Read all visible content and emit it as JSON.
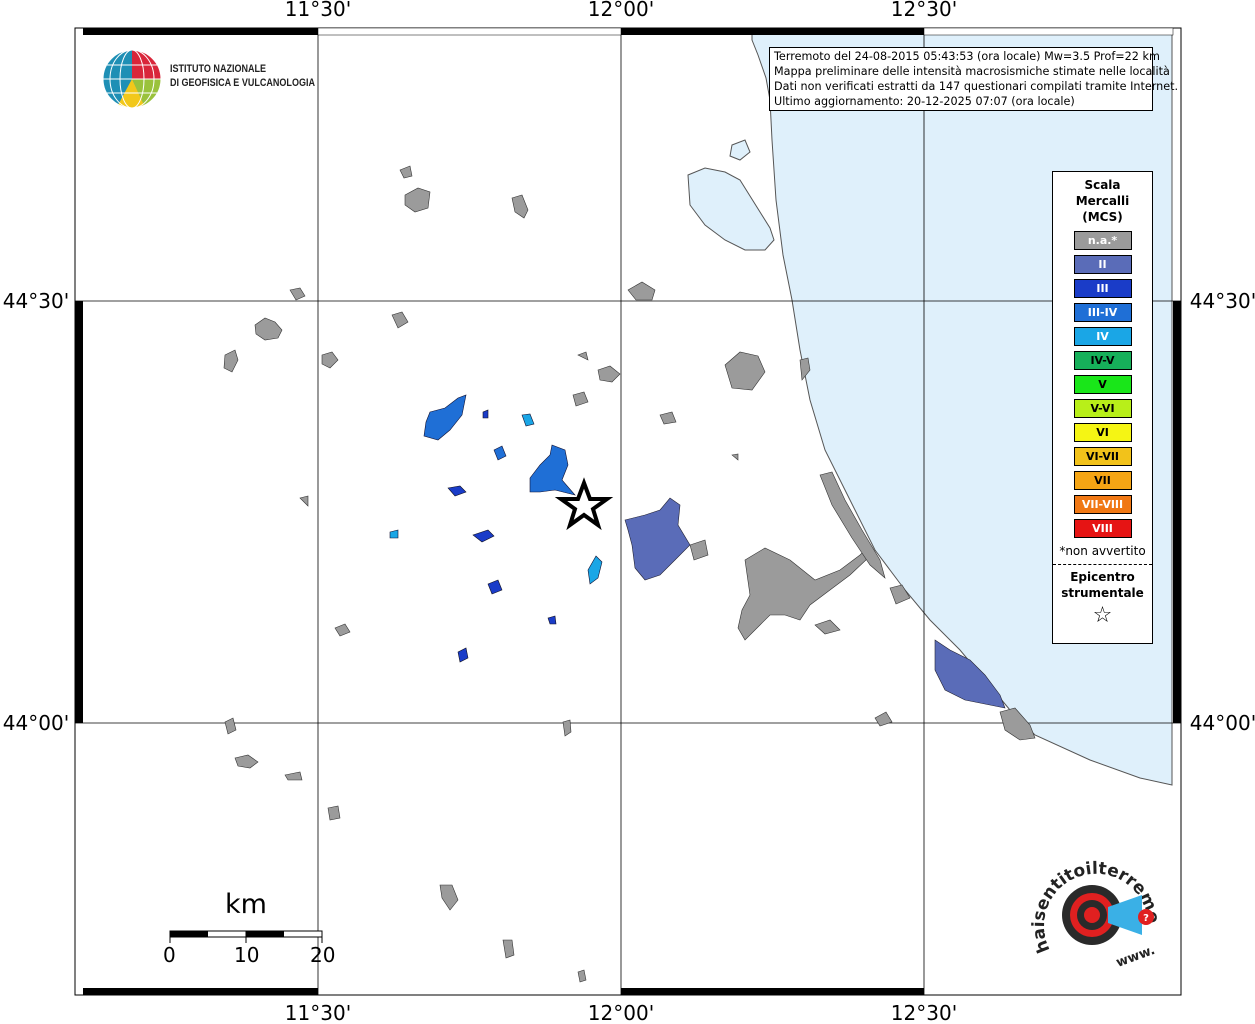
{
  "map": {
    "lon_ticks": [
      "11°30'",
      "12°00'",
      "12°30'"
    ],
    "lat_ticks": [
      "44°30'",
      "44°00'"
    ],
    "epicenter_symbol": "star",
    "colors": {
      "sea": "#dff0fb",
      "locality_na": "#9b9b9b",
      "grid": "#000000"
    }
  },
  "info": {
    "line1": "Terremoto del 24-08-2015 05:43:53 (ora locale) Mw=3.5 Prof=22 km",
    "line2": "Mappa preliminare delle intensità macrosismiche stimate nelle località",
    "line3": "Dati non verificati estratti da 147 questionari compilati tramite Internet.",
    "line4": "Ultimo aggiornamento: 20-12-2025 07:07 (ora locale)"
  },
  "legend": {
    "title_line1": "Scala",
    "title_line2": "Mercalli",
    "title_line3": "(MCS)",
    "items": [
      {
        "label": "n.a.*",
        "color": "#9b9b9b"
      },
      {
        "label": "II",
        "color": "#5a6cb8"
      },
      {
        "label": "III",
        "color": "#1a3cc8"
      },
      {
        "label": "III-IV",
        "color": "#1f6fd6"
      },
      {
        "label": "IV",
        "color": "#1aa6e6"
      },
      {
        "label": "IV-V",
        "color": "#16b05a"
      },
      {
        "label": "V",
        "color": "#19e619"
      },
      {
        "label": "V-VI",
        "color": "#b8ef19"
      },
      {
        "label": "VI",
        "color": "#f5f514"
      },
      {
        "label": "VI-VII",
        "color": "#f2c21a"
      },
      {
        "label": "VII",
        "color": "#f5a514"
      },
      {
        "label": "VII-VIII",
        "color": "#f07814"
      },
      {
        "label": "VIII",
        "color": "#e61414"
      }
    ],
    "note": "*non avvertito",
    "epicenter_line1": "Epicentro",
    "epicenter_line2": "strumentale",
    "epicenter_symbol": "☆"
  },
  "logo_ingv": {
    "line1": "ISTITUTO NAZIONALE",
    "line2": "DI GEOFISICA E VULCANOLOGIA"
  },
  "logo_hst": {
    "text": "haisentitoilterremoto.it",
    "www": "www."
  },
  "scalebar": {
    "unit": "km",
    "labels": [
      "0",
      "10",
      "20"
    ]
  }
}
